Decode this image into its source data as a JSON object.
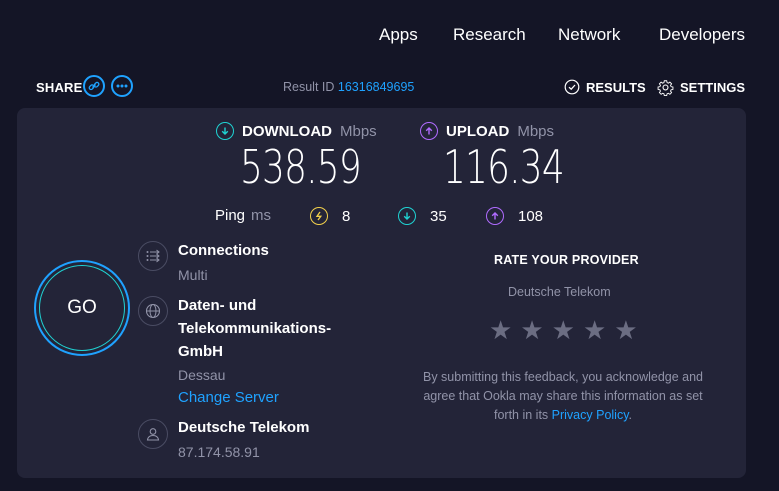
{
  "nav": {
    "items": [
      "Apps",
      "Research",
      "Network",
      "Developers"
    ]
  },
  "share": {
    "label": "SHARE"
  },
  "result": {
    "prefix": "Result ID",
    "id": "16316849695"
  },
  "actions": {
    "results": "RESULTS",
    "settings": "SETTINGS"
  },
  "download": {
    "label": "DOWNLOAD",
    "unit": "Mbps",
    "value": "538.59"
  },
  "upload": {
    "label": "UPLOAD",
    "unit": "Mbps",
    "value": "116.34"
  },
  "ping": {
    "label": "Ping",
    "unit": "ms",
    "idle": "8",
    "download": "35",
    "upload": "108"
  },
  "go": {
    "label": "GO"
  },
  "connections": {
    "title": "Connections",
    "value": "Multi"
  },
  "server": {
    "name_line1": "Daten- und",
    "name_line2": "Telekommunikations-",
    "name_line3": "GmbH",
    "location": "Dessau",
    "change": "Change Server"
  },
  "isp": {
    "name": "Deutsche Telekom",
    "ip": "87.174.58.91"
  },
  "rate": {
    "title": "RATE YOUR PROVIDER",
    "provider": "Deutsche Telekom",
    "stars_filled": 0,
    "stars_total": 5,
    "disclaimer_1": "By submitting this feedback, you acknowledge and",
    "disclaimer_2": "agree that Ookla may share this information as set",
    "disclaimer_3": "forth in its",
    "privacy": "Privacy Policy",
    "disclaimer_end": "."
  },
  "colors": {
    "accent": "#1fa2ff",
    "download": "#1fd3d3",
    "upload": "#b06bff",
    "ping_idle": "#f2d04b"
  }
}
